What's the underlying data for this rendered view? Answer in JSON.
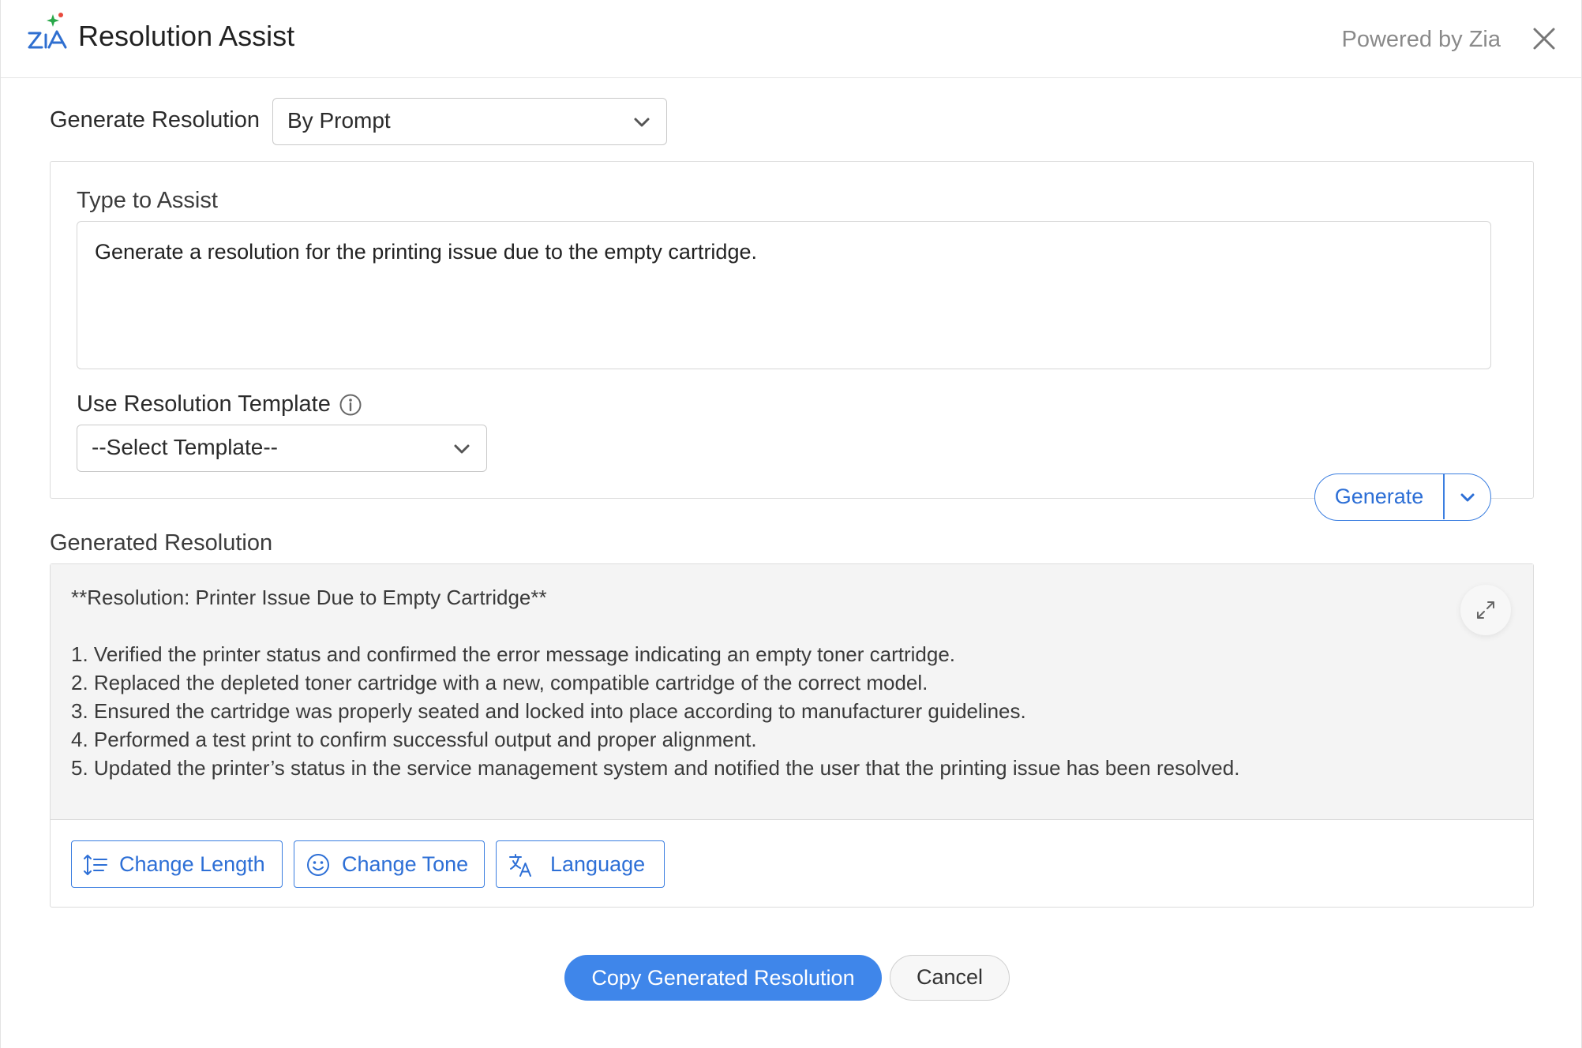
{
  "header": {
    "title": "Resolution Assist",
    "powered_by": "Powered by Zia",
    "logo_icon": "zia-logo-icon",
    "close_icon": "close-icon"
  },
  "generate": {
    "label": "Generate Resolution",
    "mode_selected": "By Prompt"
  },
  "assist": {
    "type_label": "Type to Assist",
    "prompt_value": "Generate a resolution for the printing issue due to the empty cartridge.",
    "template_label": "Use Resolution Template",
    "template_selected": "--Select Template--",
    "generate_button": "Generate"
  },
  "result": {
    "label": "Generated Resolution",
    "heading": "**Resolution: Printer Issue Due to Empty Cartridge**",
    "steps": [
      "1. Verified the printer status and confirmed the error message indicating an empty toner cartridge.",
      "2. Replaced the depleted toner cartridge with a new, compatible cartridge of the correct model.",
      "3. Ensured the cartridge was properly seated and locked into place according to manufacturer guidelines.",
      "4. Performed a test print to confirm successful output and proper alignment.",
      "5. Updated the printer’s status in the service management system and notified the user that the printing issue has been resolved."
    ],
    "tools": {
      "change_length": "Change Length",
      "change_tone": "Change Tone",
      "language": "Language"
    }
  },
  "footer": {
    "copy_button": "Copy Generated Resolution",
    "cancel_button": "Cancel"
  },
  "colors": {
    "accent": "#3f86ea",
    "accent_text": "#2d6fd6",
    "result_background": "#f4f4f4"
  }
}
